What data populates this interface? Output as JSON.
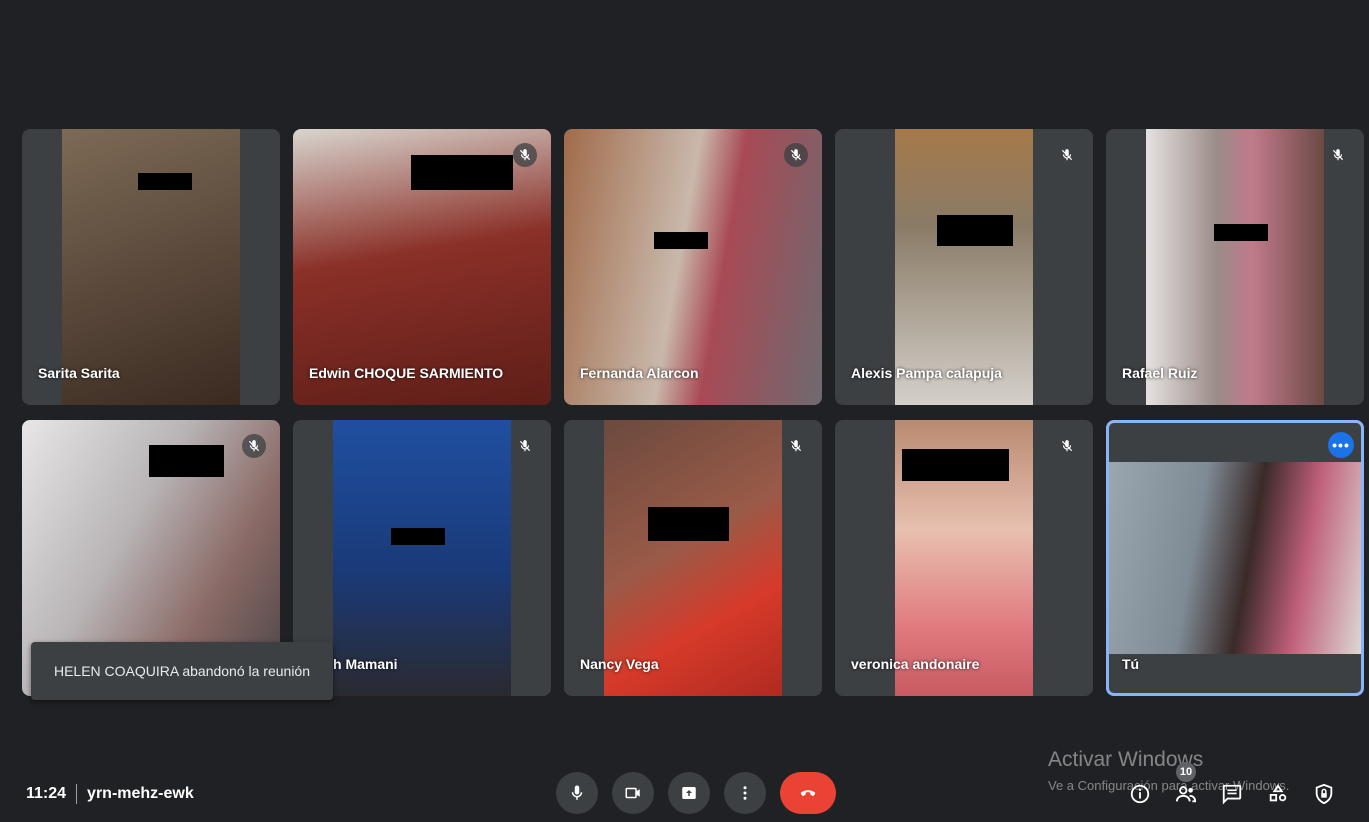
{
  "participants": [
    {
      "name": "Sarita Sarita",
      "muted": false,
      "bg": "#5b4a3c"
    },
    {
      "name": "Edwin CHOQUE SARMIENTO",
      "muted": true,
      "bg": "#7a2a24"
    },
    {
      "name": "Fernanda Alarcon",
      "muted": true,
      "bg": "#8d6e58"
    },
    {
      "name": "Alexis Pampa calapuja",
      "muted": true,
      "bg": "#8a7b66"
    },
    {
      "name": "Rafael Ruiz",
      "muted": true,
      "bg": "#9a8c88"
    },
    {
      "name": "",
      "muted": true,
      "bg": "#b9b5b7"
    },
    {
      "name": "h Mamani",
      "muted": true,
      "bg": "#1f4fa0"
    },
    {
      "name": "Nancy Vega",
      "muted": true,
      "bg": "#6b4a3e"
    },
    {
      "name": "veronica andonaire",
      "muted": true,
      "bg": "#c87a6e"
    },
    {
      "name": "Tú",
      "muted": false,
      "self": true,
      "bg": "#7e8a94"
    }
  ],
  "toast": "HELEN COAQUIRA abandonó la reunión",
  "meeting": {
    "time": "11:24",
    "code": "yrn-mehz-ewk"
  },
  "people_count": "10",
  "watermark": {
    "title": "Activar Windows",
    "subtitle": "Ve a Configuración para activar Windows."
  },
  "colors": {
    "background": "#202124",
    "tile": "#3c4043",
    "accent": "#8ab4f8",
    "end_call": "#ea4335"
  }
}
